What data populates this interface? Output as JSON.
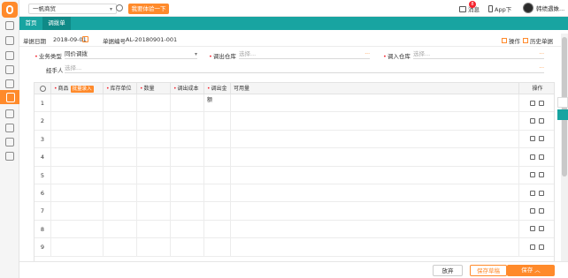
{
  "colors": {
    "accent": "#ff8a2b",
    "teal": "#18a4a1",
    "required": "#f5222d"
  },
  "topbar": {
    "company": "一帆商贸",
    "try_button": "我要体验一下",
    "messages_label": "消息",
    "messages_badge": "8",
    "app_label": "App下",
    "user_name": "韩绩遇姝..."
  },
  "tabs": [
    {
      "label": "首页"
    },
    {
      "label": "调拨单"
    }
  ],
  "doc": {
    "date_label": "单据日期",
    "date_value": "2018-09-01",
    "no_label": "单据编号",
    "no_value": "AL-20180901-001",
    "op_label": "操作",
    "history_label": "历史单据"
  },
  "form": {
    "biz_type_label": "业务类型",
    "biz_type_value": "同价调拨",
    "out_wh_label": "调出仓库",
    "out_wh_placeholder": "选择...",
    "in_wh_label": "调入仓库",
    "in_wh_placeholder": "选择...",
    "handler_label": "经手人",
    "handler_placeholder": "选择..."
  },
  "grid": {
    "columns": {
      "product": "商品",
      "batch_tag": "批量录入",
      "unit": "库存单位",
      "qty": "数量",
      "cost": "调出成本",
      "amount": "调出金额",
      "available": "可用量",
      "ops": "操作"
    },
    "rows": [
      "1",
      "2",
      "3",
      "4",
      "5",
      "6",
      "7",
      "8",
      "9"
    ]
  },
  "footer": {
    "cancel": "放弃",
    "draft": "保存草稿",
    "save": "保存"
  }
}
